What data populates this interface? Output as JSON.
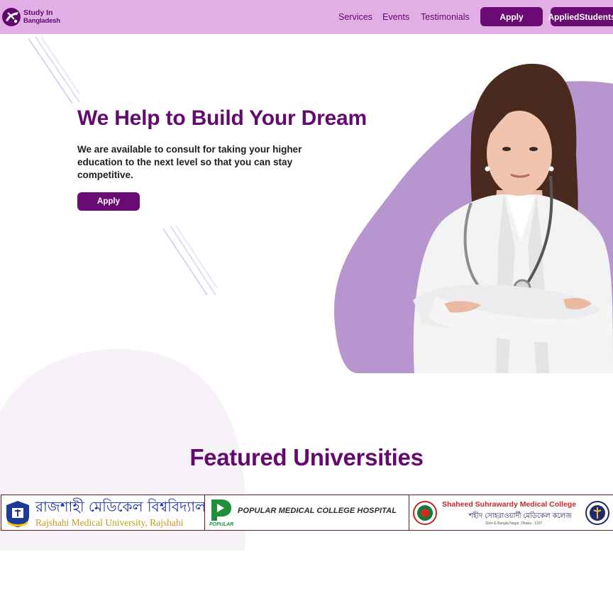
{
  "navbar": {
    "brand_line1": "Study In",
    "brand_line2": "Bangladesh",
    "links": [
      "Services",
      "Events",
      "Testimonials"
    ],
    "apply_label": "Apply",
    "applied_students_label": "AppliedStudents"
  },
  "hero": {
    "title": "We Help to Build Your Dream",
    "subtitle": "We are available to consult for taking your higher education to the next level so that you can stay competitive.",
    "apply_label": "Apply"
  },
  "featured": {
    "title": "Featured Universities",
    "universities": [
      {
        "name_bn": "রাজশাহী মেডিকেল বিশ্ববিদ্যালয়, রাজশাহী",
        "name_en": "Rajshahi Medical University, Rajshahi"
      },
      {
        "name": "POPULAR MEDICAL COLLEGE HOSPITAL",
        "logo_caption": "POPULAR"
      },
      {
        "name_en": "Shaheed Suhrawardy Medical College",
        "name_bn": "শহীদ সোহরাওয়ার্দী মেডিকেল কলেজ",
        "address": "Sher-E-Bangla Nagar, Dhaka - 1207"
      }
    ]
  },
  "colors": {
    "navbar_bg": "#e2aee6",
    "brand_purple": "#640a6f",
    "button_purple": "#6a0a73",
    "blob_lavender": "#b795cf",
    "blob_pale": "#f7f2f8"
  },
  "icons": [
    "logo-mark-icon",
    "rmu-emblem-icon",
    "popular-p-icon",
    "bangladesh-seal-icon",
    "ssmc-emblem-icon"
  ]
}
